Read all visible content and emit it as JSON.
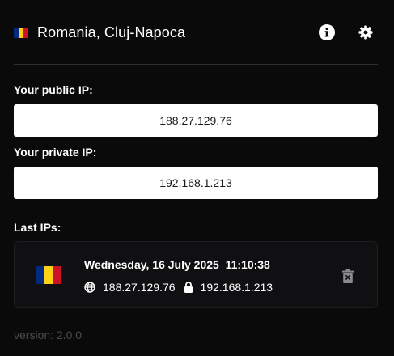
{
  "header": {
    "country_flag": "romania-flag",
    "location": "Romania, Cluj-Napoca",
    "actions": [
      {
        "name": "info-icon"
      },
      {
        "name": "gear-icon"
      }
    ]
  },
  "public_ip": {
    "label": "Your public IP:",
    "value": "188.27.129.76"
  },
  "private_ip": {
    "label": "Your private IP:",
    "value": "192.168.1.213"
  },
  "history": {
    "label": "Last IPs:",
    "entries": [
      {
        "flag": "romania-flag",
        "date": "Wednesday, 16 July 2025",
        "time": "11:10:38",
        "public_ip": "188.27.129.76",
        "private_ip": "192.168.1.213"
      }
    ]
  },
  "footer": {
    "version": "version: 2.0.0"
  },
  "colors": {
    "background": "#0a0a0b",
    "flag_blue": "#002b7f",
    "flag_yellow": "#fcd116",
    "flag_red": "#ce1126",
    "muted": "#4a4a50"
  }
}
